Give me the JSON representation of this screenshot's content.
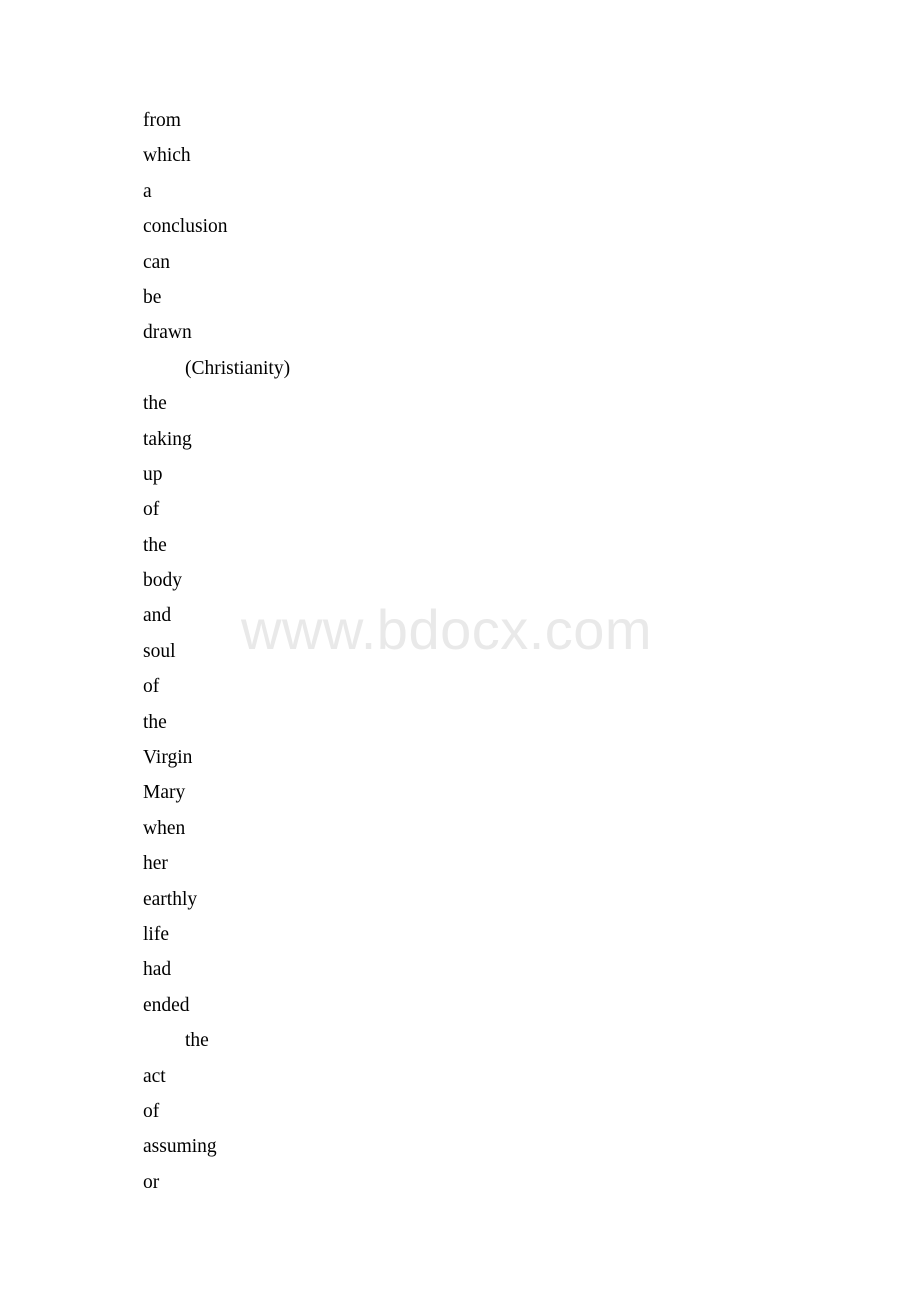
{
  "document": {
    "background_color": "#ffffff",
    "text_color": "#000000",
    "watermark": {
      "text": "www.bdocx.com",
      "color": "#e9e9e9"
    },
    "lines": [
      {
        "text": "from",
        "indent": "normal"
      },
      {
        "text": "which",
        "indent": "normal"
      },
      {
        "text": "a",
        "indent": "normal"
      },
      {
        "text": "conclusion",
        "indent": "normal"
      },
      {
        "text": "can",
        "indent": "normal"
      },
      {
        "text": "be",
        "indent": "normal"
      },
      {
        "text": "drawn",
        "indent": "normal"
      },
      {
        "text": "(Christianity)",
        "indent": "indent"
      },
      {
        "text": "the",
        "indent": "normal"
      },
      {
        "text": "taking",
        "indent": "normal"
      },
      {
        "text": "up",
        "indent": "normal"
      },
      {
        "text": "of",
        "indent": "normal"
      },
      {
        "text": "the",
        "indent": "normal"
      },
      {
        "text": "body",
        "indent": "normal"
      },
      {
        "text": "and",
        "indent": "normal"
      },
      {
        "text": "soul",
        "indent": "normal"
      },
      {
        "text": "of",
        "indent": "normal"
      },
      {
        "text": "the",
        "indent": "normal"
      },
      {
        "text": "Virgin",
        "indent": "normal"
      },
      {
        "text": "Mary",
        "indent": "normal"
      },
      {
        "text": "when",
        "indent": "normal"
      },
      {
        "text": "her",
        "indent": "normal"
      },
      {
        "text": "earthly",
        "indent": "normal"
      },
      {
        "text": "life",
        "indent": "normal"
      },
      {
        "text": "had",
        "indent": "normal"
      },
      {
        "text": "ended",
        "indent": "normal"
      },
      {
        "text": "the",
        "indent": "indent"
      },
      {
        "text": "act",
        "indent": "normal"
      },
      {
        "text": "of",
        "indent": "normal"
      },
      {
        "text": "assuming",
        "indent": "normal"
      },
      {
        "text": "or",
        "indent": "normal"
      }
    ]
  }
}
